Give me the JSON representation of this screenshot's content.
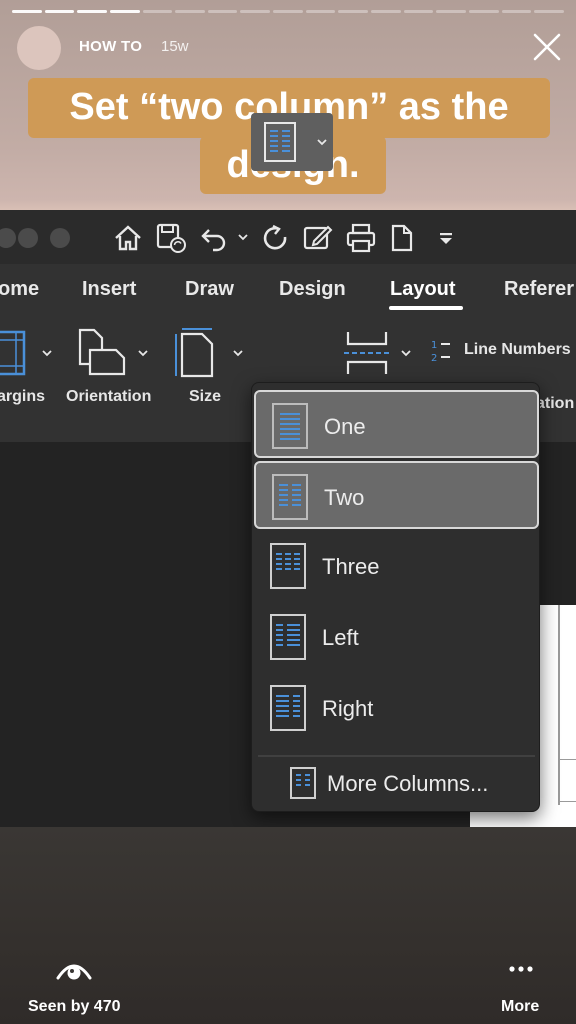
{
  "story": {
    "progress_total": 17,
    "progress_done": 4,
    "account_name": "HOW TO",
    "posted_ago": "15w",
    "caption_line1": "Set “two column” as the",
    "caption_line2": "design."
  },
  "word": {
    "tabs": [
      "ome",
      "Insert",
      "Draw",
      "Design",
      "Layout",
      "Referer"
    ],
    "active_tab": "Layout",
    "ribbon": {
      "margins_label": "argins",
      "orientation_label": "Orientation",
      "size_label": "Size",
      "line_numbers_label": "Line Numbers",
      "hyphenation_label": "ation"
    },
    "columns_menu": {
      "items": [
        "One",
        "Two",
        "Three",
        "Left",
        "Right"
      ],
      "highlighted": [
        "One",
        "Two"
      ],
      "more_label": "More Columns..."
    }
  },
  "footer": {
    "seen_label": "Seen by 470",
    "more_label": "More"
  },
  "colors": {
    "caption_bg": "#cf9a56",
    "accent_icon_blue": "#4a90d9",
    "app_bg": "#323232"
  }
}
